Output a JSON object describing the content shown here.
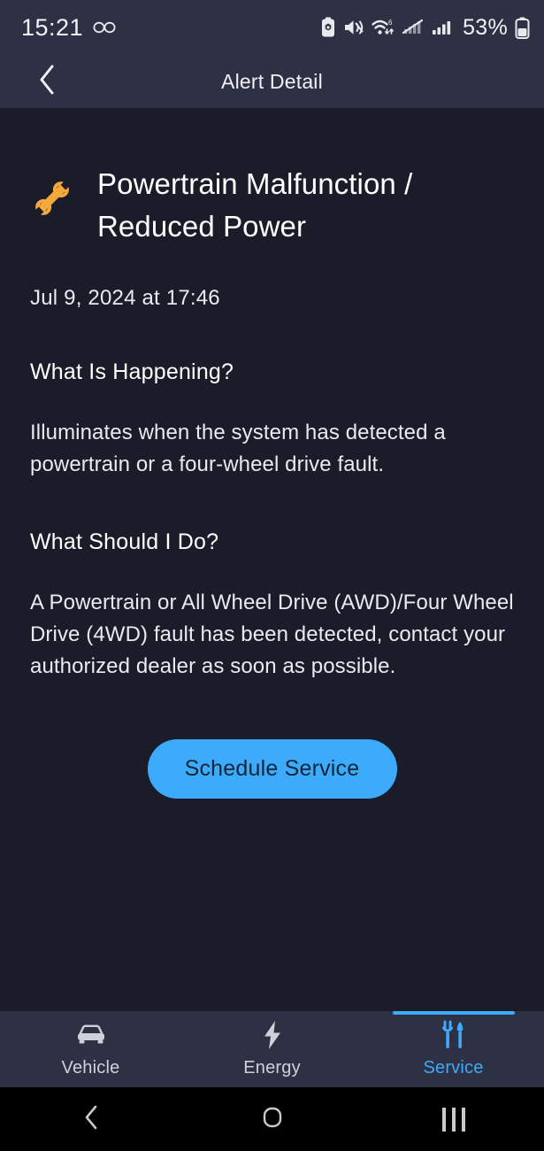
{
  "status_bar": {
    "time": "15:21",
    "battery_percent": "53%",
    "icons": [
      "glasses-icon",
      "battery-saver-icon",
      "mute-icon",
      "wifi6-icon",
      "no-sim-icon",
      "signal-bars-icon",
      "battery-icon"
    ]
  },
  "header": {
    "title": "Alert Detail",
    "back_icon": "chevron-left-icon"
  },
  "alert": {
    "icon": "wrench-icon",
    "icon_color": "#f5a93d",
    "title": "Powertrain Malfunction / Reduced Power",
    "timestamp": "Jul 9, 2024 at 17:46",
    "sections": [
      {
        "heading": "What Is Happening?",
        "body": "Illuminates when the system has detected a powertrain or a four-wheel drive fault."
      },
      {
        "heading": "What Should I Do?",
        "body": "A Powertrain or All Wheel Drive (AWD)/Four Wheel Drive (4WD) fault has been detected, contact your authorized dealer as soon as possible."
      }
    ],
    "cta_label": "Schedule Service",
    "cta_color": "#3cabfb"
  },
  "tab_bar": {
    "active_color": "#3cabfb",
    "tabs": [
      {
        "label": "Vehicle",
        "icon": "car-icon",
        "active": false
      },
      {
        "label": "Energy",
        "icon": "bolt-icon",
        "active": false
      },
      {
        "label": "Service",
        "icon": "wrench-screwdriver-icon",
        "active": true
      }
    ]
  },
  "system_nav": {
    "back": "nav-back-icon",
    "home": "nav-home-icon",
    "recents": "nav-recents-icon"
  }
}
